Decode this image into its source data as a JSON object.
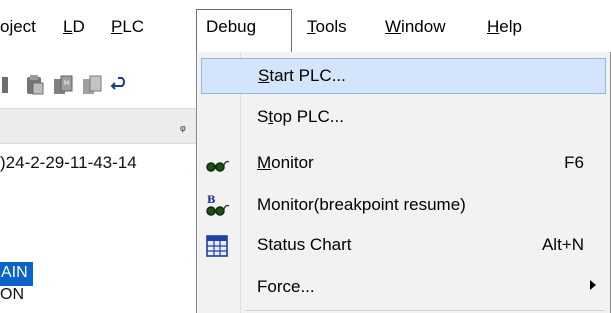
{
  "menubar": {
    "items": [
      {
        "label": "oject",
        "accel": ""
      },
      {
        "label": "LD",
        "accel_char": "L",
        "rest": "D"
      },
      {
        "label": "PLC",
        "accel_char": "P",
        "rest": "LC"
      },
      {
        "label": "Debug",
        "accel_char": "",
        "rest": "Debug"
      },
      {
        "label": "Tools",
        "accel_char": "T",
        "rest": "ools"
      },
      {
        "label": "Window",
        "accel_char": "W",
        "rest": "indow"
      },
      {
        "label": "Help",
        "accel_char": "H",
        "rest": "elp"
      }
    ]
  },
  "background": {
    "project_text": ")24-2-29-11-43-14",
    "selected_item": "AIN",
    "next_item": "ON"
  },
  "debug_menu": {
    "items": [
      {
        "pre": "",
        "accel_char": "S",
        "post": "tart PLC...",
        "shortcut": "",
        "icon": "",
        "submenu": false
      },
      {
        "pre": "S",
        "accel_char": "t",
        "post": "op PLC...",
        "shortcut": "",
        "icon": "",
        "submenu": false
      },
      {
        "pre": "",
        "accel_char": "M",
        "post": "onitor",
        "shortcut": "F6",
        "icon": "glasses-icon",
        "submenu": false
      },
      {
        "pre": "Monitor(breakpoint resume)",
        "accel_char": "",
        "post": "",
        "shortcut": "",
        "icon": "breakpoint-glasses-icon",
        "submenu": false
      },
      {
        "pre": "Status Chart",
        "accel_char": "",
        "post": "",
        "shortcut": "Alt+N",
        "icon": "status-chart-icon",
        "submenu": false
      },
      {
        "pre": "Force...",
        "accel_char": "",
        "post": "",
        "shortcut": "",
        "icon": "",
        "submenu": true
      }
    ]
  },
  "colors": {
    "hover_bg": "#d3e5fa",
    "selection_bg": "#0a63c9"
  }
}
